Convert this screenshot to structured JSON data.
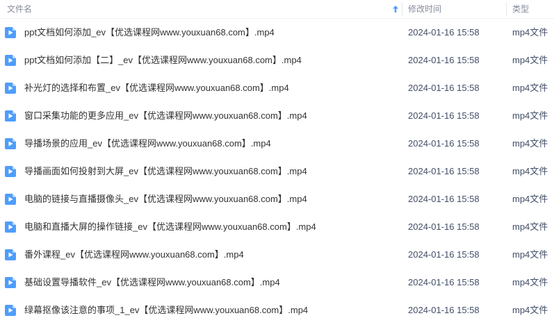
{
  "header": {
    "name_label": "文件名",
    "time_label": "修改时间",
    "type_label": "类型",
    "sort_icon": "arrow-up-icon"
  },
  "colors": {
    "icon_blue": "#4f9dfc",
    "header_text": "#878c9c",
    "row_text": "#333333",
    "sort_arrow": "#4f9dfc"
  },
  "files": [
    {
      "name": "ppt文档如何添加_ev【优选课程网www.youxuan68.com】.mp4",
      "time": "2024-01-16 15:58",
      "type": "mp4文件",
      "icon": "video-file-icon"
    },
    {
      "name": "ppt文档如何添加【二】_ev【优选课程网www.youxuan68.com】.mp4",
      "time": "2024-01-16 15:58",
      "type": "mp4文件",
      "icon": "video-file-icon"
    },
    {
      "name": "补光灯的选择和布置_ev【优选课程网www.youxuan68.com】.mp4",
      "time": "2024-01-16 15:58",
      "type": "mp4文件",
      "icon": "video-file-icon"
    },
    {
      "name": "窗口采集功能的更多应用_ev【优选课程网www.youxuan68.com】.mp4",
      "time": "2024-01-16 15:58",
      "type": "mp4文件",
      "icon": "video-file-icon"
    },
    {
      "name": "导播场景的应用_ev【优选课程网www.youxuan68.com】.mp4",
      "time": "2024-01-16 15:58",
      "type": "mp4文件",
      "icon": "video-file-icon"
    },
    {
      "name": "导播画面如何投射到大屏_ev【优选课程网www.youxuan68.com】.mp4",
      "time": "2024-01-16 15:58",
      "type": "mp4文件",
      "icon": "video-file-icon"
    },
    {
      "name": "电脑的链接与直播摄像头_ev【优选课程网www.youxuan68.com】.mp4",
      "time": "2024-01-16 15:58",
      "type": "mp4文件",
      "icon": "video-file-icon"
    },
    {
      "name": "电脑和直播大屏的操作链接_ev【优选课程网www.youxuan68.com】.mp4",
      "time": "2024-01-16 15:58",
      "type": "mp4文件",
      "icon": "video-file-icon"
    },
    {
      "name": "番外课程_ev【优选课程网www.youxuan68.com】.mp4",
      "time": "2024-01-16 15:58",
      "type": "mp4文件",
      "icon": "video-file-icon"
    },
    {
      "name": "基础设置导播软件_ev【优选课程网www.youxuan68.com】.mp4",
      "time": "2024-01-16 15:58",
      "type": "mp4文件",
      "icon": "video-file-icon"
    },
    {
      "name": "绿幕抠像该注意的事项_1_ev【优选课程网www.youxuan68.com】.mp4",
      "time": "2024-01-16 15:58",
      "type": "mp4文件",
      "icon": "video-file-icon"
    }
  ]
}
